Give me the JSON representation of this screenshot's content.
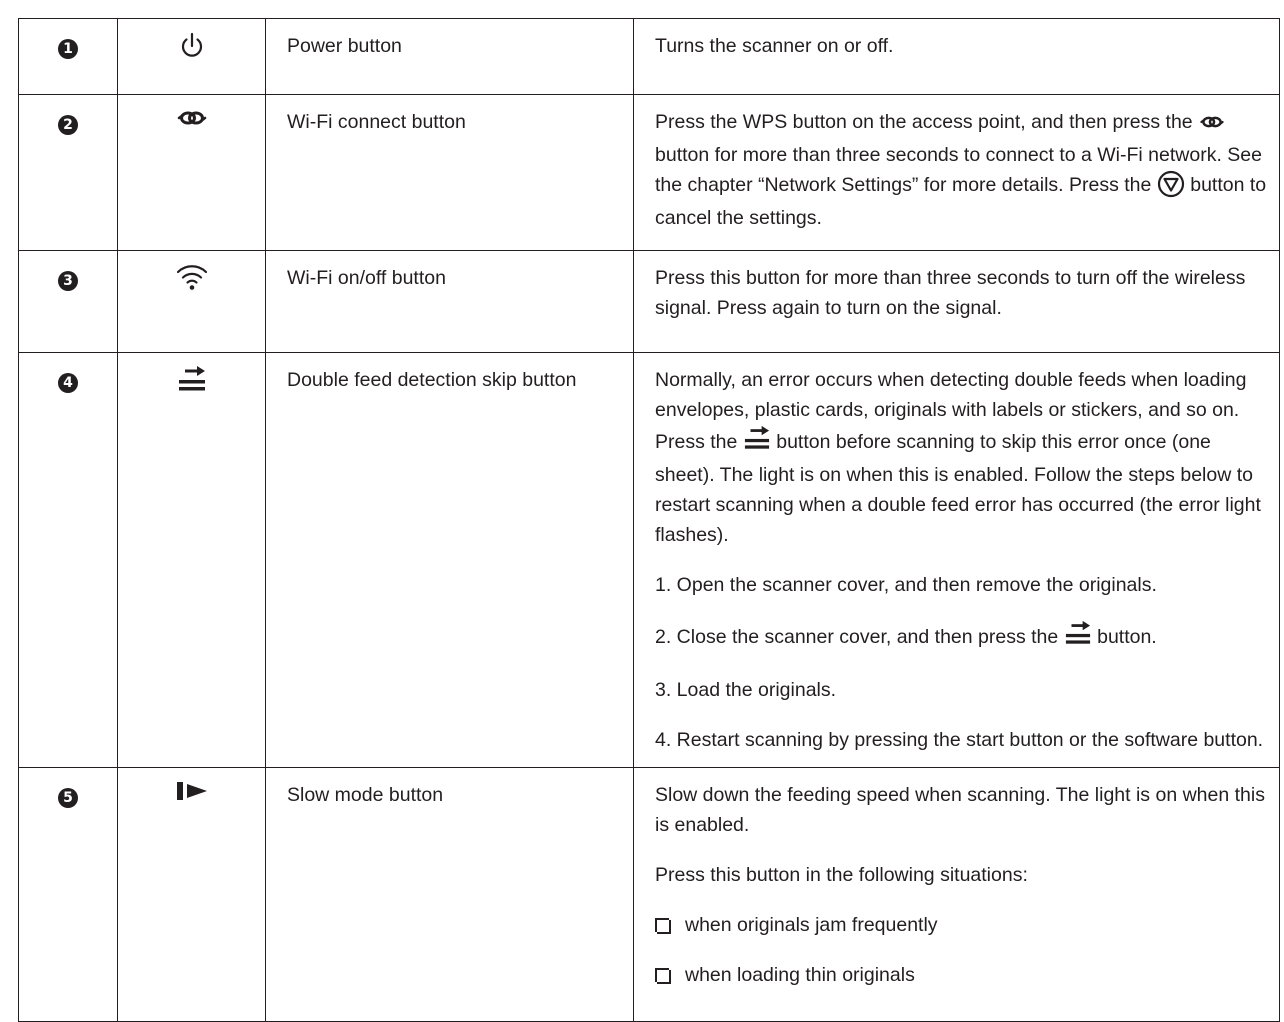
{
  "rows": [
    {
      "number": "1",
      "icon": "power-icon",
      "name": "Power button",
      "desc_text": "Turns the scanner on or off."
    },
    {
      "number": "2",
      "icon": "wifi-connect-link-icon",
      "name": "Wi-Fi connect button",
      "desc_a": "Press the WPS button on the access point, and then press the",
      "desc_b": "button for more than three seconds to connect to a Wi-Fi network. See the chapter “Network Settings” for more details. Press the",
      "desc_c": "button to cancel the settings."
    },
    {
      "number": "3",
      "icon": "wifi-icon",
      "name": "Wi-Fi on/off button",
      "desc_text": "Press this button for more than three seconds to turn off the wireless signal. Press again to turn on the signal."
    },
    {
      "number": "4",
      "icon": "double-feed-skip-icon",
      "name": "Double feed detection skip button",
      "desc_a": "Normally, an error occurs when detecting double feeds when loading envelopes, plastic cards, originals with labels or stickers, and so on. Press the",
      "desc_b": "button before scanning to skip this error once (one sheet). The light is on when this is enabled. Follow the steps below to restart scanning when a double feed error has occurred (the error light flashes).",
      "step1": "1. Open the scanner cover, and then remove the originals.",
      "step2_a": "2. Close the scanner cover, and then press the",
      "step2_b": "button.",
      "step3": "3. Load the originals.",
      "step4": "4. Restart scanning by pressing the start button or the software button."
    },
    {
      "number": "5",
      "icon": "slow-mode-icon",
      "name": "Slow mode button",
      "desc_text": "Slow down the feeding speed when scanning. The light is on when this is enabled.",
      "situations_intro": "Press this button in the following situations:",
      "situations": [
        "when originals jam frequently",
        "when loading thin originals"
      ]
    }
  ]
}
